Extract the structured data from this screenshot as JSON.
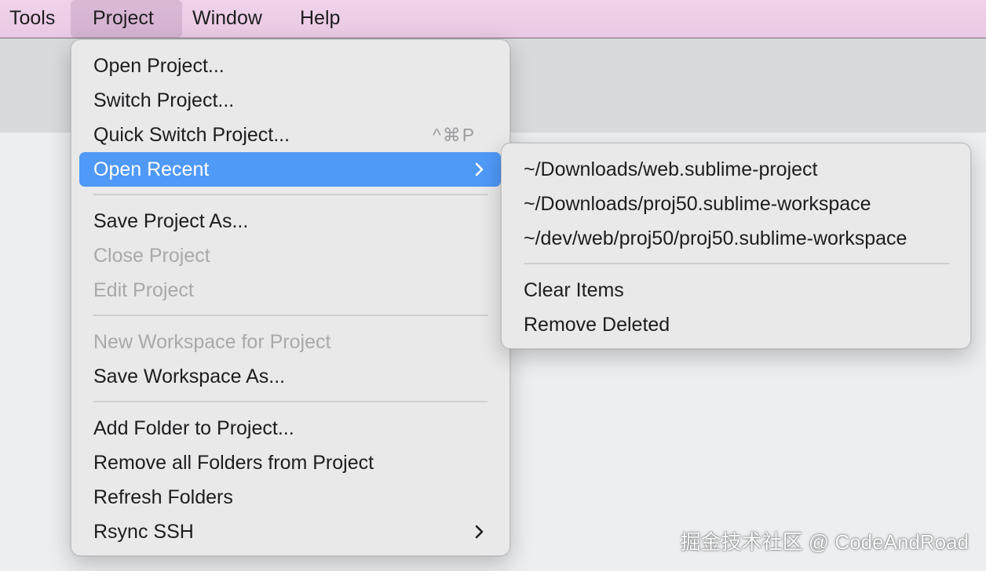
{
  "menubar": {
    "items": [
      {
        "label": "Tools"
      },
      {
        "label": "Project"
      },
      {
        "label": "Window"
      },
      {
        "label": "Help"
      }
    ]
  },
  "project_menu": {
    "items": [
      {
        "label": "Open Project..."
      },
      {
        "label": "Switch Project..."
      },
      {
        "label": "Quick Switch Project...",
        "shortcut": "^⌘P"
      },
      {
        "label": "Open Recent"
      },
      {
        "label": "Save Project As..."
      },
      {
        "label": "Close Project"
      },
      {
        "label": "Edit Project"
      },
      {
        "label": "New Workspace for Project"
      },
      {
        "label": "Save Workspace As..."
      },
      {
        "label": "Add Folder to Project..."
      },
      {
        "label": "Remove all Folders from Project"
      },
      {
        "label": "Refresh Folders"
      },
      {
        "label": "Rsync SSH"
      }
    ]
  },
  "recent_menu": {
    "items": [
      {
        "label": "~/Downloads/web.sublime-project"
      },
      {
        "label": "~/Downloads/proj50.sublime-workspace"
      },
      {
        "label": "~/dev/web/proj50/proj50.sublime-workspace"
      },
      {
        "label": "Clear Items"
      },
      {
        "label": "Remove Deleted"
      }
    ]
  },
  "icons": {
    "submenu_chevron": "chevron-right-icon"
  },
  "colors": {
    "menubar_bg": "#ecccE6",
    "highlight": "#4f99f7",
    "disabled_text": "#a9a9ab"
  },
  "watermark": "掘金技术社区 @ CodeAndRoad"
}
